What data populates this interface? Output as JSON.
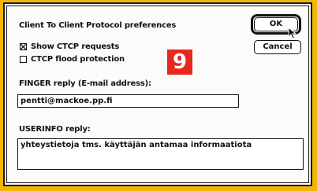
{
  "dialog": {
    "title": "Client To Client Protocol preferences",
    "ok_label": "OK",
    "cancel_label": "Cancel"
  },
  "options": {
    "show_ctcp": {
      "label": "Show CTCP requests",
      "checked": true
    },
    "flood_protection": {
      "label": "CTCP flood protection",
      "checked": false
    }
  },
  "finger": {
    "label": "FINGER reply (E-mail address):",
    "value": "pentti@mackoe.pp.fi"
  },
  "userinfo": {
    "label": "USERINFO reply:",
    "value": "yhteystietoja tms. käyttäjän antamaa informaatiota"
  },
  "badge": {
    "text": "9",
    "color": "#e8281e"
  },
  "colors": {
    "background": "#f2b705",
    "dialog": "#fbfbf9"
  }
}
